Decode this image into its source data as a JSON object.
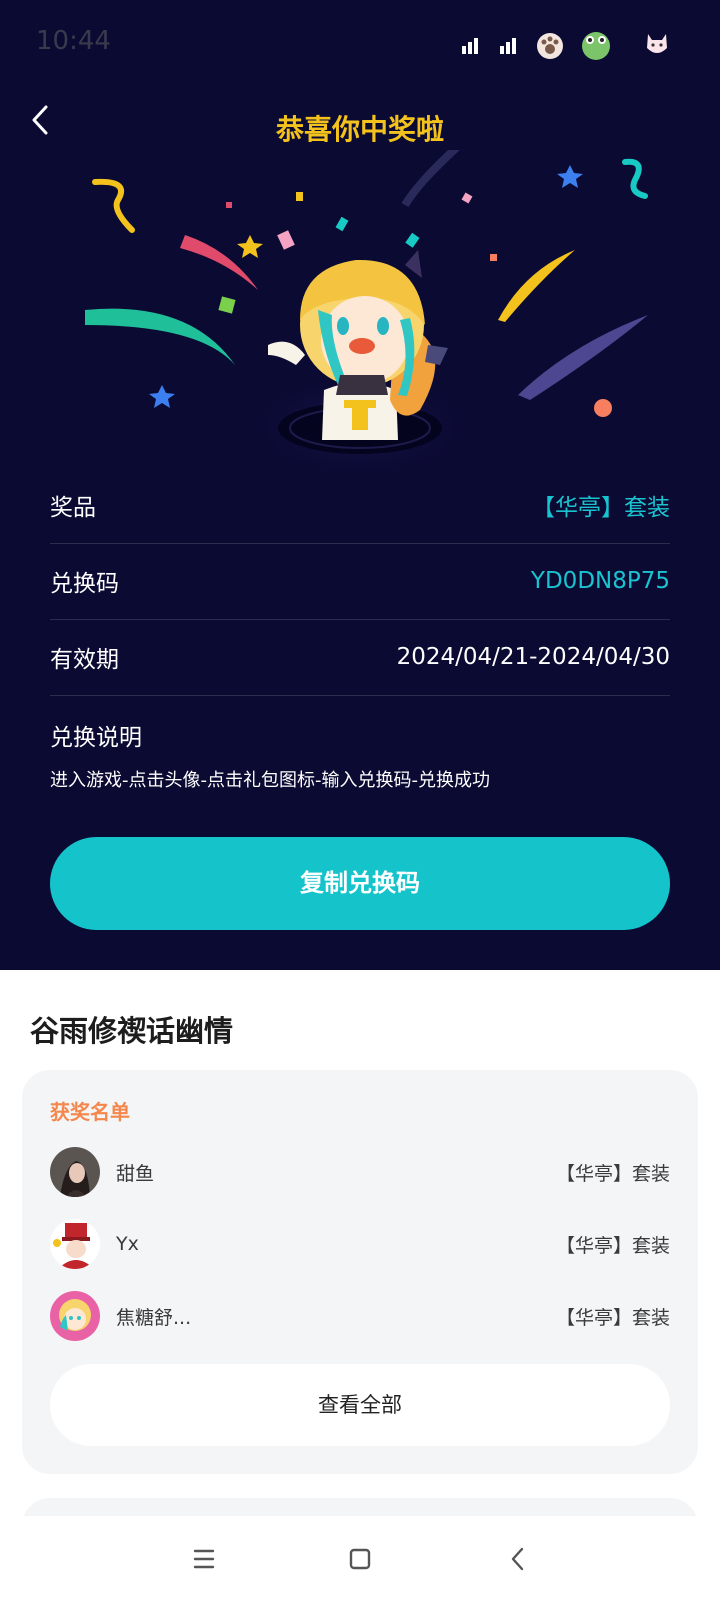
{
  "status_bar": {
    "time": "10:44"
  },
  "header": {
    "title": "恭喜你中奖啦"
  },
  "prize_info": {
    "prize_label": "奖品",
    "prize_value": "【华亭】套装",
    "code_label": "兑换码",
    "code_value": "YD0DN8P75",
    "validity_label": "有效期",
    "validity_value": "2024/04/21-2024/04/30",
    "instructions_label": "兑换说明",
    "instructions_text": "进入游戏-点击头像-点击礼包图标-输入兑换码-兑换成功"
  },
  "copy_button": {
    "label": "复制兑换码"
  },
  "activity": {
    "title": "谷雨修禊话幽情"
  },
  "winners": {
    "heading": "获奖名单",
    "items": [
      {
        "name": "甜鱼",
        "prize": "【华亭】套装"
      },
      {
        "name": "Yx",
        "prize": "【华亭】套装"
      },
      {
        "name": "焦糖舒...",
        "prize": "【华亭】套装"
      }
    ],
    "view_all_label": "查看全部"
  },
  "colors": {
    "background_dark": "#0b0a33",
    "accent_cyan": "#15c3cb",
    "title_yellow": "#f4c21c",
    "heading_orange": "#f4874c"
  },
  "icons": {
    "back": "chevron-left-icon",
    "menu": "menu-icon",
    "home": "home-square-icon",
    "nav_back": "nav-back-icon"
  }
}
